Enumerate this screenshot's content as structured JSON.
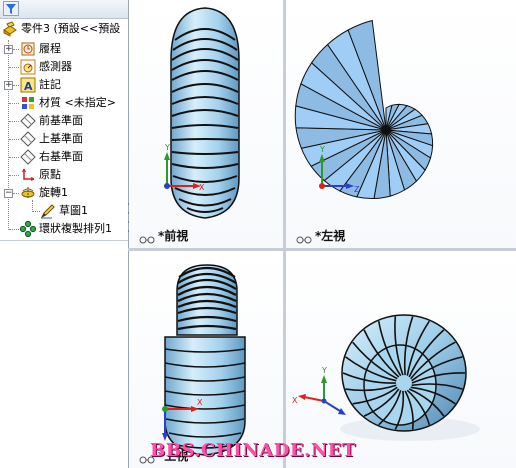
{
  "feature_tree": {
    "root_label": "零件3 (預設<<預設",
    "items": [
      {
        "label": "履程",
        "icon": "history-icon"
      },
      {
        "label": "感測器",
        "icon": "sensor-icon"
      },
      {
        "label": "註記",
        "icon": "annotation-icon"
      },
      {
        "label": "材質 <未指定>",
        "icon": "material-icon"
      },
      {
        "label": "前基準面",
        "icon": "plane-icon"
      },
      {
        "label": "上基準面",
        "icon": "plane-icon"
      },
      {
        "label": "右基準面",
        "icon": "plane-icon"
      },
      {
        "label": "原點",
        "icon": "origin-icon"
      },
      {
        "label": "旋轉1",
        "icon": "revolve-icon"
      },
      {
        "label": "草圖1",
        "icon": "sketch-icon"
      },
      {
        "label": "環狀複製排列1",
        "icon": "circular-pattern-icon"
      }
    ]
  },
  "viewports": {
    "front": {
      "label": "*前視"
    },
    "left": {
      "label": "*左視"
    },
    "top": {
      "label": "*上視"
    }
  },
  "watermark": "BBS.CHINADE.NET",
  "colors": {
    "model_fill": "#a8d4ee",
    "model_edge": "#101010",
    "axis_x": "#e0201a",
    "axis_y": "#2a9a2a",
    "axis_z": "#2a3fcf"
  }
}
